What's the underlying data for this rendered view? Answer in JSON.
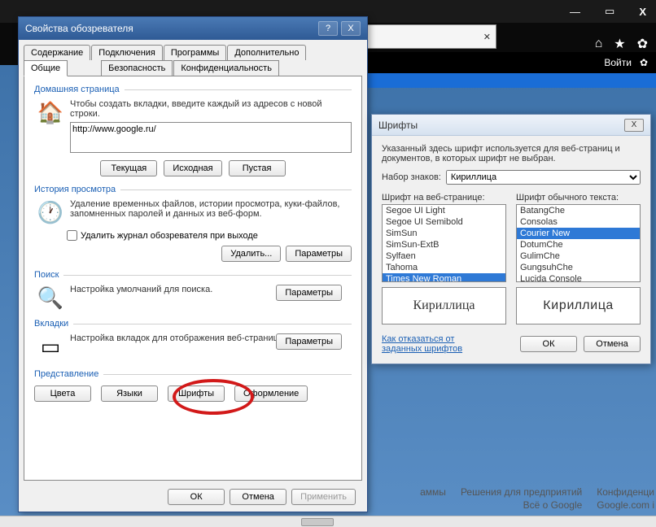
{
  "chrome": {
    "min": "—",
    "max": "▭",
    "close": "X"
  },
  "toolbar": {
    "tab_close": "✕",
    "login": "Войти",
    "home_icon": "⌂",
    "star_icon": "★",
    "gear_icon": "✿"
  },
  "dialog1": {
    "title": "Свойства обозревателя",
    "help": "?",
    "close": "X",
    "tabs_row1": [
      "Содержание",
      "Подключения",
      "Программы",
      "Дополнительно"
    ],
    "tabs_row2": [
      "Общие",
      "Безопасность",
      "Конфиденциальность"
    ],
    "home": {
      "group": "Домашняя страница",
      "desc": "Чтобы создать вкладки, введите каждый из адресов с новой строки.",
      "url": "http://www.google.ru/",
      "btn_current": "Текущая",
      "btn_default": "Исходная",
      "btn_blank": "Пустая"
    },
    "history": {
      "group": "История просмотра",
      "desc": "Удаление временных файлов, истории просмотра, куки-файлов, запомненных паролей и данных из веб-форм.",
      "chk": "Удалить журнал обозревателя при выходе",
      "btn_delete": "Удалить...",
      "btn_params": "Параметры"
    },
    "search": {
      "group": "Поиск",
      "desc": "Настройка умолчаний для поиска.",
      "btn": "Параметры"
    },
    "tabsgrp": {
      "group": "Вкладки",
      "desc": "Настройка вкладок для отображения веб-страниц.",
      "btn": "Параметры"
    },
    "appearance": {
      "group": "Представление",
      "btn_colors": "Цвета",
      "btn_lang": "Языки",
      "btn_fonts": "Шрифты",
      "btn_design": "Оформление"
    },
    "footer": {
      "ok": "ОК",
      "cancel": "Отмена",
      "apply": "Применить"
    }
  },
  "dialog2": {
    "title": "Шрифты",
    "close": "X",
    "intro": "Указанный здесь шрифт используется для веб-страниц и документов, в которых шрифт не выбран.",
    "charset_label": "Набор знаков:",
    "charset_value": "Кириллица",
    "web_label": "Шрифт на веб-странице:",
    "plain_label": "Шрифт обычного текста:",
    "web_fonts": [
      "Segoe UI Light",
      "Segoe UI Semibold",
      "SimSun",
      "SimSun-ExtB",
      "Sylfaen",
      "Tahoma",
      "Times New Roman"
    ],
    "plain_fonts": [
      "BatangChe",
      "Consolas",
      "Courier New",
      "DotumChe",
      "GulimChe",
      "GungsuhChe",
      "Lucida Console"
    ],
    "preview_web": "Кириллица",
    "preview_plain": "Кириллица",
    "link": "Как отказаться от заданных шрифтов",
    "ok": "ОК",
    "cancel": "Отмена"
  },
  "page": {
    "l1a": "аммы",
    "l1b": "Решения для предприятий",
    "l1c": "Конфиденци",
    "l2a": "Всё о Google",
    "l2b": "Google.com i"
  }
}
